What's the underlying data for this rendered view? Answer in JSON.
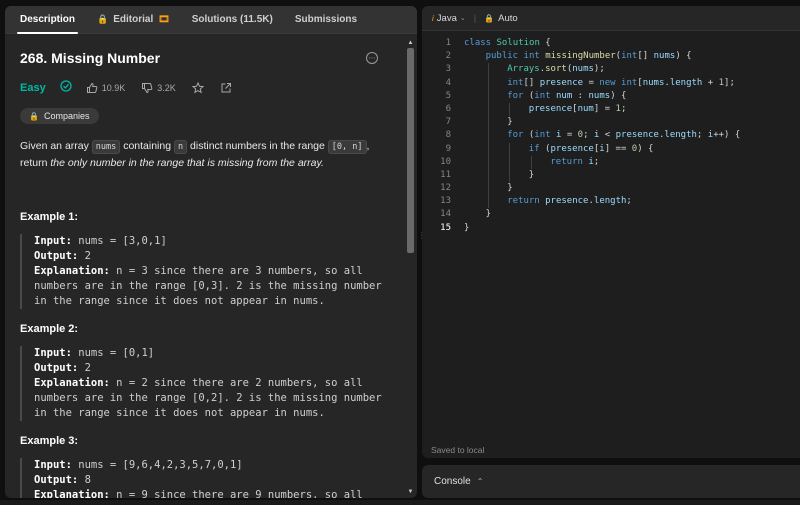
{
  "tabs": [
    {
      "label": "Description",
      "active": true
    },
    {
      "label": "Editorial",
      "locked": true,
      "badge": "🎞"
    },
    {
      "label": "Solutions (11.5K)"
    },
    {
      "label": "Submissions"
    }
  ],
  "problem": {
    "title": "268. Missing Number",
    "difficulty": "Easy",
    "likes": "10.9K",
    "dislikes": "3.2K",
    "companies_label": "Companies",
    "desc_1": "Given an array ",
    "desc_code_1": "nums",
    "desc_2": " containing ",
    "desc_code_2": "n",
    "desc_3": " distinct numbers in the range ",
    "desc_code_3": "[0, n]",
    "desc_4": ", return ",
    "desc_em": "the only number in the range that is missing from the array."
  },
  "examples": [
    {
      "title": "Example 1:",
      "input_label": "Input:",
      "input": " nums = [3,0,1]",
      "output_label": "Output:",
      "output": " 2",
      "explanation_label": "Explanation:",
      "explanation_lines": [
        " n = 3 since there are 3 numbers, so all",
        "numbers are in the range [0,3]. 2 is the missing number",
        "in the range since it does not appear in nums."
      ]
    },
    {
      "title": "Example 2:",
      "input_label": "Input:",
      "input": " nums = [0,1]",
      "output_label": "Output:",
      "output": " 2",
      "explanation_label": "Explanation:",
      "explanation_lines": [
        " n = 2 since there are 2 numbers, so all",
        "numbers are in the range [0,2]. 2 is the missing number",
        "in the range since it does not appear in nums."
      ]
    },
    {
      "title": "Example 3:",
      "input_label": "Input:",
      "input": " nums = [9,6,4,2,3,5,7,0,1]",
      "output_label": "Output:",
      "output": " 8",
      "explanation_label": "Explanation:",
      "explanation_lines": [
        " n = 9 since there are 9 numbers, so all"
      ]
    }
  ],
  "editor": {
    "language": "Java",
    "mode": "Auto",
    "saved_text": "Saved to local",
    "lines": [
      {
        "n": "1",
        "indent": 0,
        "code": "class Solution {"
      },
      {
        "n": "2",
        "indent": 1,
        "code": "public int missingNumber(int[] nums) {"
      },
      {
        "n": "3",
        "indent": 2,
        "code": "Arrays.sort(nums);"
      },
      {
        "n": "4",
        "indent": 2,
        "code": "int[] presence = new int[nums.length + 1];"
      },
      {
        "n": "5",
        "indent": 2,
        "code": "for (int num : nums) {"
      },
      {
        "n": "6",
        "indent": 3,
        "code": "presence[num] = 1;"
      },
      {
        "n": "7",
        "indent": 2,
        "code": "}"
      },
      {
        "n": "8",
        "indent": 2,
        "code": "for (int i = 0; i < presence.length; i++) {"
      },
      {
        "n": "9",
        "indent": 3,
        "code": "if (presence[i] == 0) {"
      },
      {
        "n": "10",
        "indent": 4,
        "code": "return i;"
      },
      {
        "n": "11",
        "indent": 3,
        "code": "}"
      },
      {
        "n": "12",
        "indent": 2,
        "code": "}"
      },
      {
        "n": "13",
        "indent": 2,
        "code": "return presence.length;"
      },
      {
        "n": "14",
        "indent": 1,
        "code": "}"
      },
      {
        "n": "15",
        "indent": 0,
        "code": "}"
      }
    ]
  },
  "console": {
    "label": "Console"
  },
  "colors": {
    "easy": "#00b8a3",
    "accent": "#ffa116",
    "keyword": "#569cd6",
    "type": "#4ec9b0",
    "method": "#dcdcaa",
    "number": "#b5cea8",
    "variable": "#9cdcfe"
  }
}
